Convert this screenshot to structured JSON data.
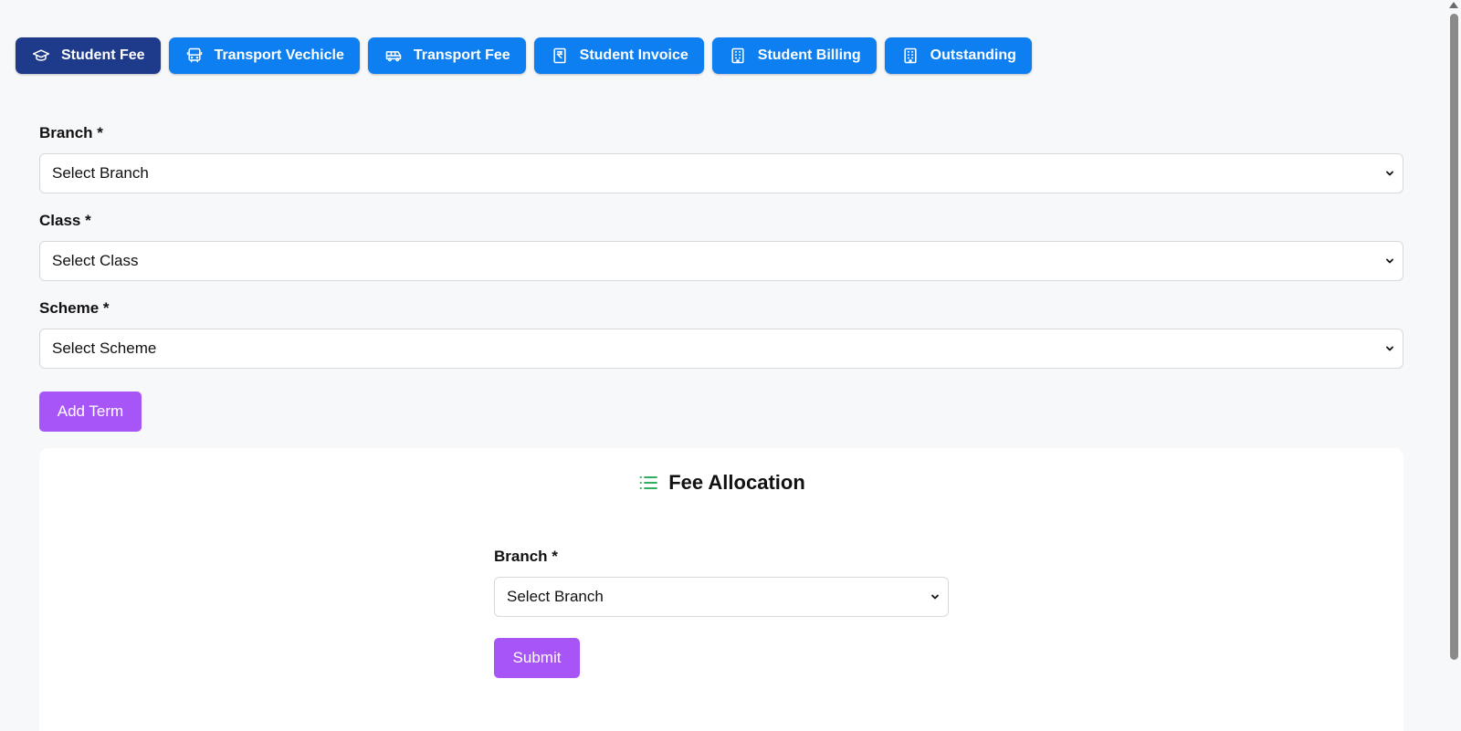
{
  "tabs": [
    {
      "label": "Student Fee",
      "icon": "graduation-cap-icon",
      "active": true
    },
    {
      "label": "Transport Vechicle",
      "icon": "bus-icon",
      "active": false
    },
    {
      "label": "Transport Fee",
      "icon": "van-icon",
      "active": false
    },
    {
      "label": "Student Invoice",
      "icon": "rupee-receipt-icon",
      "active": false
    },
    {
      "label": "Student Billing",
      "icon": "building-icon",
      "active": false
    },
    {
      "label": "Outstanding",
      "icon": "building-icon",
      "active": false
    }
  ],
  "form": {
    "branch": {
      "label": "Branch *",
      "value": "Select Branch"
    },
    "class": {
      "label": "Class *",
      "value": "Select Class"
    },
    "scheme": {
      "label": "Scheme *",
      "value": "Select Scheme"
    },
    "add_term_label": "Add Term"
  },
  "fee_allocation": {
    "title": "Fee Allocation",
    "icon": "list-icon",
    "branch": {
      "label": "Branch *",
      "value": "Select Branch"
    },
    "submit_label": "Submit"
  },
  "colors": {
    "tab_blue": "#0d7ff0",
    "tab_active": "#1e3a8a",
    "button_purple": "#a855f7",
    "list_icon_green": "#16a34a"
  }
}
